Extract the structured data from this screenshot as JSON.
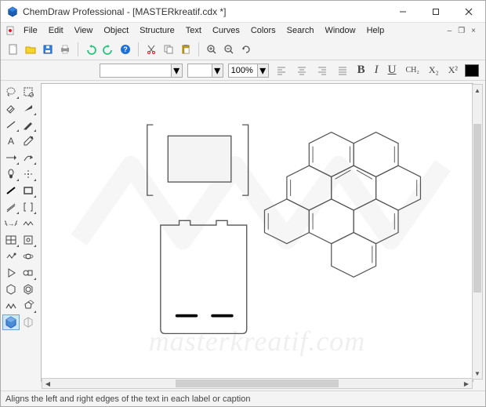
{
  "window": {
    "title": "ChemDraw Professional - [MASTERkreatif.cdx *]"
  },
  "menu": {
    "items": [
      "File",
      "Edit",
      "View",
      "Object",
      "Structure",
      "Text",
      "Curves",
      "Colors",
      "Search",
      "Window",
      "Help"
    ]
  },
  "toolbar2": {
    "font_value": "",
    "size_value": "",
    "zoom_value": "100%",
    "bold": "B",
    "italic": "I",
    "underline": "U",
    "ch2": "CH₂",
    "x2": "X₂",
    "x2sup": "X²"
  },
  "status": {
    "text": "Aligns the left and right edges of the text in each label or caption"
  },
  "watermark": "masterkreatif.com"
}
